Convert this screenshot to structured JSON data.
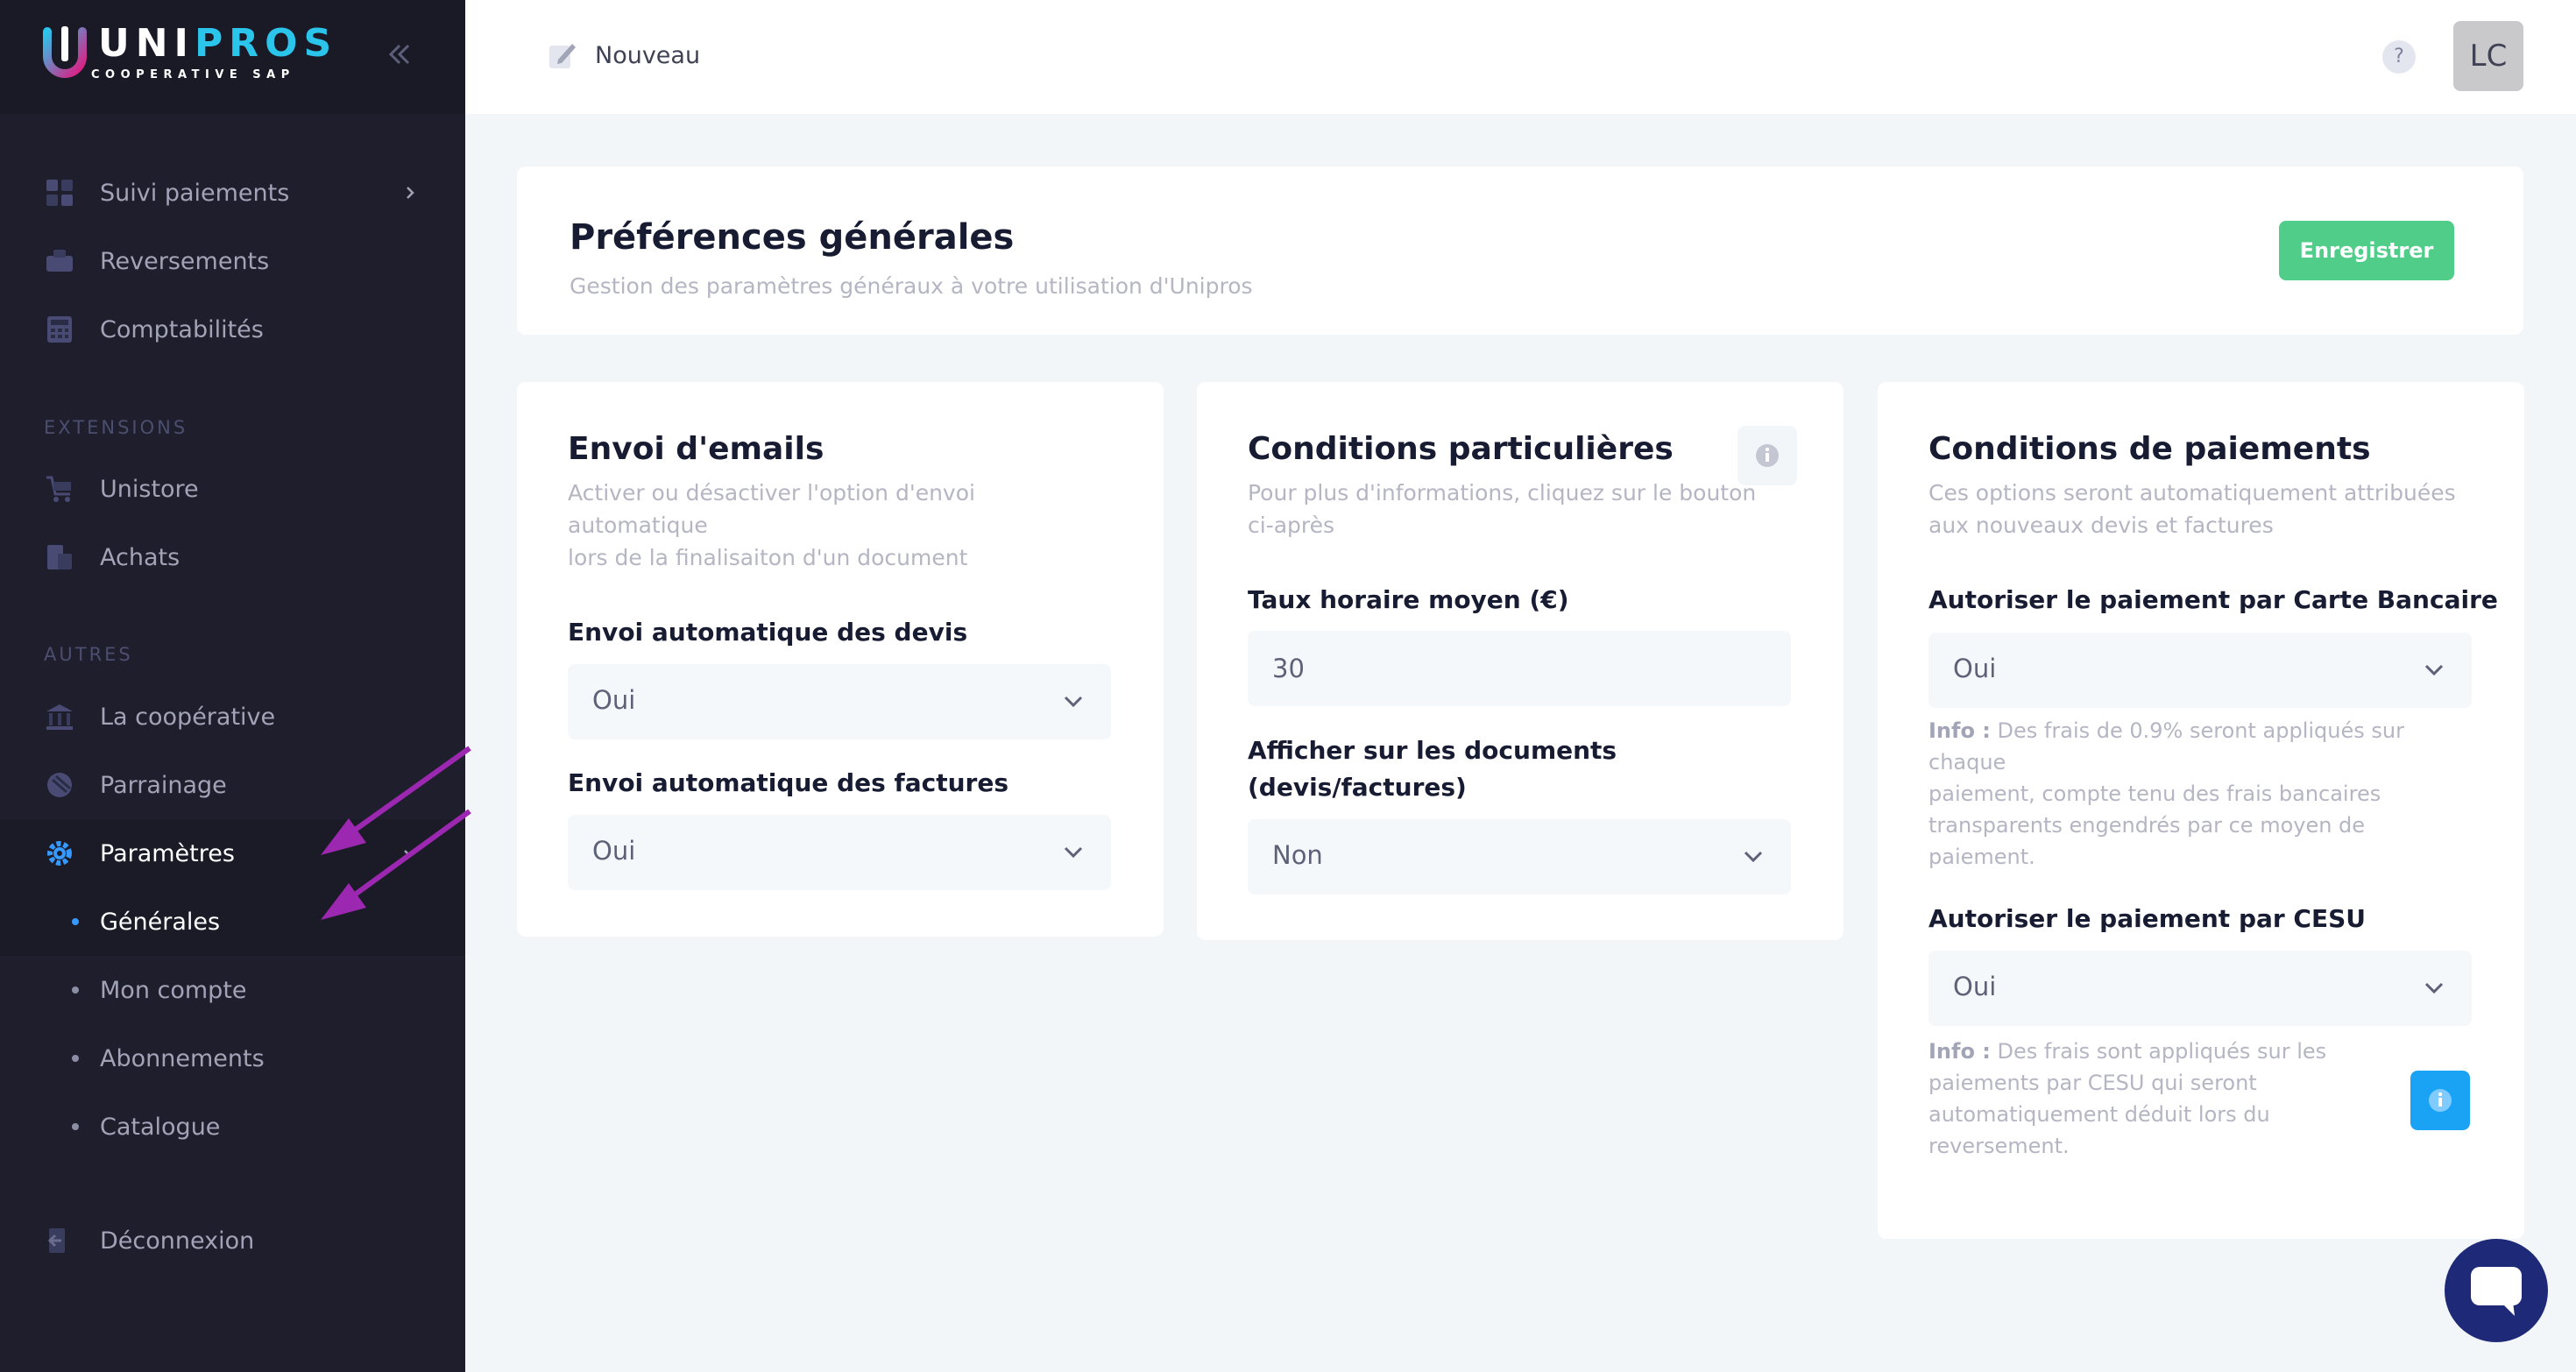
{
  "brand": {
    "name_a": "UNI",
    "name_b": "PROS",
    "tagline": "COOPERATIVE SAP"
  },
  "sidebar": {
    "items": [
      {
        "label": "Suivi paiements",
        "icon": "payments-icon"
      },
      {
        "label": "Reversements",
        "icon": "transfer-icon"
      },
      {
        "label": "Comptabilités",
        "icon": "calculator-icon"
      }
    ],
    "extensions_label": "EXTENSIONS",
    "extensions": [
      {
        "label": "Unistore",
        "icon": "cart-icon"
      },
      {
        "label": "Achats",
        "icon": "purchases-icon"
      }
    ],
    "others_label": "AUTRES",
    "others": [
      {
        "label": "La coopérative",
        "icon": "bank-icon"
      },
      {
        "label": "Parrainage",
        "icon": "sponsor-icon"
      },
      {
        "label": "Paramètres",
        "icon": "gear-icon"
      }
    ],
    "settings_sub": [
      {
        "label": "Générales"
      },
      {
        "label": "Mon compte"
      },
      {
        "label": "Abonnements"
      },
      {
        "label": "Catalogue"
      }
    ],
    "logout": "Déconnexion"
  },
  "header": {
    "new_label": "Nouveau",
    "help": "?",
    "avatar": "LC"
  },
  "page": {
    "title": "Préférences générales",
    "subtitle": "Gestion des paramètres généraux à votre utilisation d'Unipros",
    "save_label": "Enregistrer"
  },
  "emails": {
    "title": "Envoi d'emails",
    "desc_1": "Activer ou désactiver l'option d'envoi",
    "desc_2": "automatique",
    "desc_3": "lors de la finalisaiton d'un document",
    "quotes_label": "Envoi automatique des devis",
    "quotes_value": "Oui",
    "invoices_label": "Envoi automatique des factures",
    "invoices_value": "Oui"
  },
  "conditions": {
    "title": "Conditions particulières",
    "desc_1": "Pour plus d'informations, cliquez sur le bouton",
    "desc_2": "ci-après",
    "rate_label": "Taux horaire moyen (€)",
    "rate_value": "30",
    "display_label_1": "Afficher sur les documents",
    "display_label_2": "(devis/factures)",
    "display_value": "Non"
  },
  "payments": {
    "title": "Conditions de paiements",
    "desc_1": "Ces options seront automatiquement attribuées",
    "desc_2": "aux nouveaux devis et factures",
    "card_label": "Autoriser le paiement par Carte Bancaire",
    "card_value": "Oui",
    "card_info_prefix": "Info :",
    "card_info_1": " Des frais de 0.9% seront appliqués sur chaque",
    "card_info_2": "paiement, compte tenu des frais bancaires",
    "card_info_3": "transparents engendrés par ce moyen de",
    "card_info_4": "paiement.",
    "cesu_label": "Autoriser le paiement par CESU",
    "cesu_value": "Oui",
    "cesu_info_prefix": "Info :",
    "cesu_info_1": " Des frais sont appliqués sur les",
    "cesu_info_2": "paiements par CESU qui seront",
    "cesu_info_3": "automatiquement déduit lors du",
    "cesu_info_4": "reversement."
  },
  "colors": {
    "sidebar_bg": "#1e1e2d",
    "accent_blue": "#3699ff",
    "save_green": "#50cd89",
    "annotation_purple": "#9c27b0"
  }
}
